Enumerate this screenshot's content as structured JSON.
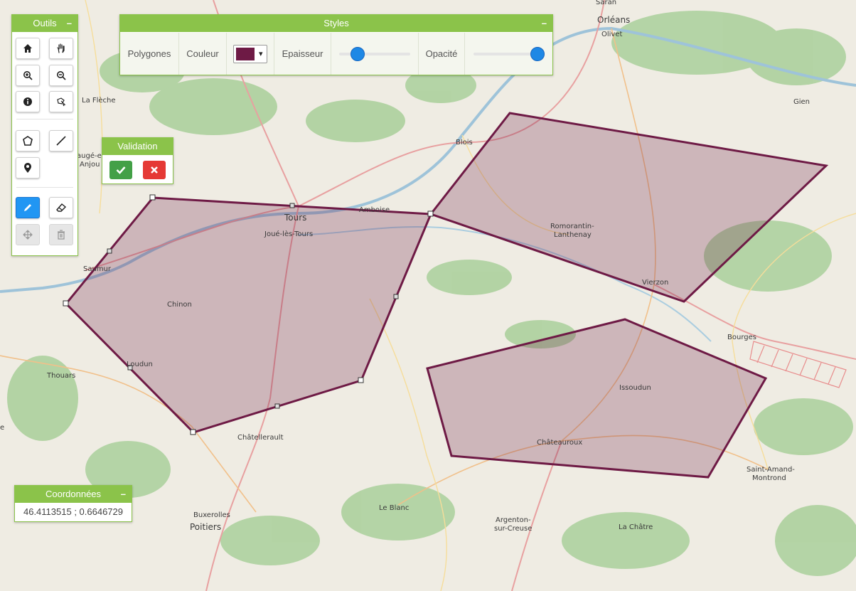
{
  "colors": {
    "accent": "#8bc34a",
    "polygon_stroke": "#6e1a45",
    "polygon_fill": "#6e1a45",
    "active_tool": "#2196f3",
    "validate": "#43a047",
    "cancel": "#e53935",
    "slider": "#1e88e5"
  },
  "tools_panel": {
    "title": "Outils",
    "collapse": "–",
    "buttons": [
      {
        "name": "home-icon"
      },
      {
        "name": "hand-pan-icon"
      },
      {
        "name": "zoom-in-icon"
      },
      {
        "name": "zoom-out-icon"
      },
      {
        "name": "info-icon"
      },
      {
        "name": "select-feature-icon"
      },
      {
        "name": "polygon-draw-icon"
      },
      {
        "name": "line-draw-icon"
      },
      {
        "name": "point-marker-icon"
      },
      {
        "name": "pencil-edit-icon",
        "state": "active"
      },
      {
        "name": "eraser-icon"
      },
      {
        "name": "move-icon",
        "state": "disabled"
      },
      {
        "name": "trash-icon",
        "state": "disabled"
      }
    ]
  },
  "styles_panel": {
    "title": "Styles",
    "collapse": "–",
    "type_label": "Polygones",
    "color_label": "Couleur",
    "color_value": "#6e1a45",
    "color_caret": "▾",
    "thickness_label": "Epaisseur",
    "thickness_value": 0.2,
    "opacity_label": "Opacité",
    "opacity_value": 1.0
  },
  "validation_panel": {
    "title": "Validation",
    "confirm_icon": "check-icon",
    "cancel_icon": "close-icon"
  },
  "coords_panel": {
    "title": "Coordonnées",
    "collapse": "–",
    "value": "46.4113515 ; 0.6646729"
  },
  "map": {
    "towns": {
      "saran": "Saran",
      "orleans": "Orléans",
      "olivet": "Olivet",
      "gien": "Gien",
      "la_fleche": "La Flèche",
      "beauge": "augé-en-",
      "anjou": "Anjou",
      "blois": "Blois",
      "tours": "Tours",
      "joue": "Joué-lès-Tours",
      "amboise": "Amboise",
      "romorantin": "Romorantin-",
      "lanthenay": "Lanthenay",
      "saumur": "Saumur",
      "chinon": "Chinon",
      "vierzon": "Vierzon",
      "bourges": "Bourges",
      "thouars": "Thouars",
      "loudun": "Loudun",
      "issoudun": "Issoudun",
      "chatellerault": "Châtellerault",
      "chateauroux": "Châteauroux",
      "saint_amand": "Saint-Amand-",
      "montrond": "Montrond",
      "le_blanc": "Le Blanc",
      "buxerolles": "Buxerolles",
      "poitiers": "Poitiers",
      "argenton": "Argenton-",
      "sur_creuse": "sur-Creuse",
      "la_chatre": "La Châtre",
      "edge_e": "e"
    }
  }
}
